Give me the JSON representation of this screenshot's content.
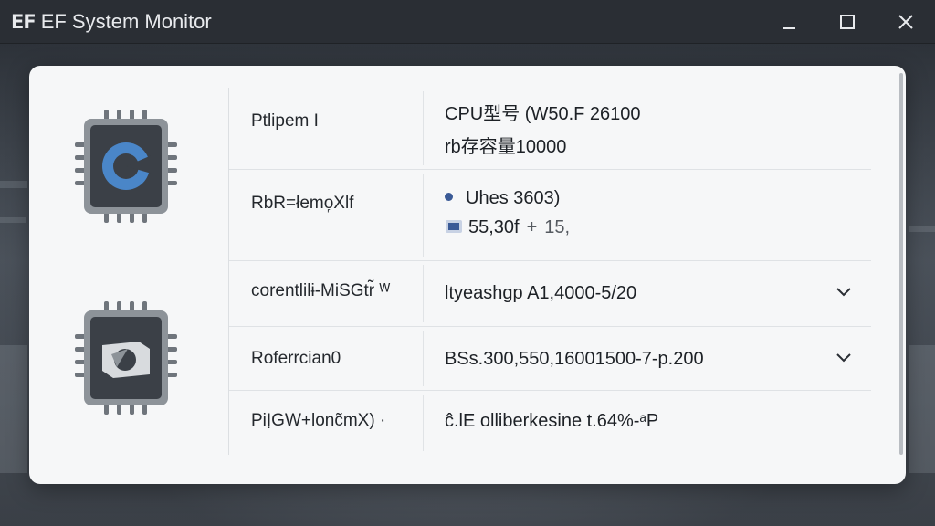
{
  "window": {
    "logo": "EF",
    "title": "EF System Monitor",
    "controls": [
      "minimize-icon",
      "maximize-icon",
      "close-icon"
    ]
  },
  "icons": {
    "chip_top": "cpu-chip-icon",
    "chip_bottom": "gpu-chip-icon"
  },
  "rows": [
    {
      "label": "Ptlipem I",
      "value_line1": "CPU型号 (W50.F 26100",
      "value_line2": "rb存容量10000"
    },
    {
      "label": "RbR=łemo᷊Xlf",
      "value_line1": "Uhes 3603)",
      "value_line2_a": "55,30f",
      "value_line2_plus": "+",
      "value_line2_b": "15,"
    },
    {
      "label": "corentlilɨ-MiSGtr̃ ᵂ",
      "value": "ltyeashgp A1,4000-5/20",
      "has_dropdown": true
    },
    {
      "label": "Roferrcian0",
      "value": "BSs.300,550,16001500-7-p.200",
      "has_dropdown": true
    },
    {
      "label": "PiỊGW+lonc̃mX) ·",
      "value": "ĉ.lE olliberkesine t.64%-ᵃP"
    }
  ],
  "colors": {
    "accent_blue": "#4a86c8",
    "dot_blue": "#3a5a96",
    "titlebar": "#2a2e34",
    "panel": "#f6f7f8"
  }
}
